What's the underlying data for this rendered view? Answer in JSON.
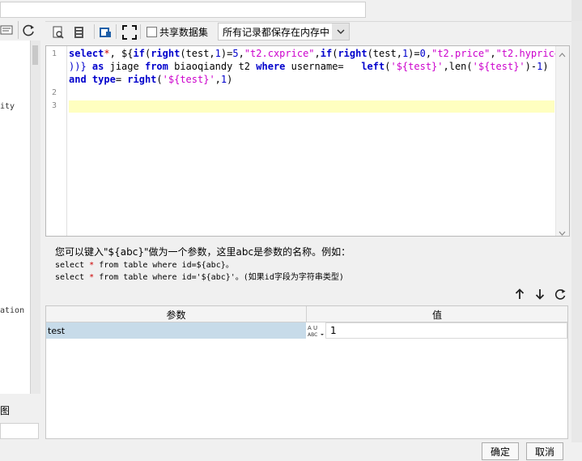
{
  "left_panel": {
    "tree_items": [
      "ity",
      "ation"
    ],
    "bottom_label": "图"
  },
  "toolbar": {
    "share_dataset_label": "共享数据集",
    "share_dataset_checked": false,
    "storage_mode_selected": "所有记录都保存在内存中"
  },
  "editor": {
    "line_numbers": [
      "1",
      "2",
      "3"
    ]
  },
  "help": {
    "line1": "您可以键入\"${abc}\"做为一个参数，这里abc是参数的名称。例如：",
    "line2_a": "select ",
    "line2_star": "*",
    "line2_b": " from table where id=${abc}。",
    "line3_a": "select ",
    "line3_star": "*",
    "line3_b": " from table where id='${abc}'。(如果id字段为字符串类型)"
  },
  "params": {
    "header_name": "参数",
    "header_value": "值",
    "rows": [
      {
        "name": "test",
        "type_icon": "ABC",
        "value": "1"
      }
    ]
  },
  "buttons": {
    "ok": "确定",
    "cancel": "取消"
  }
}
